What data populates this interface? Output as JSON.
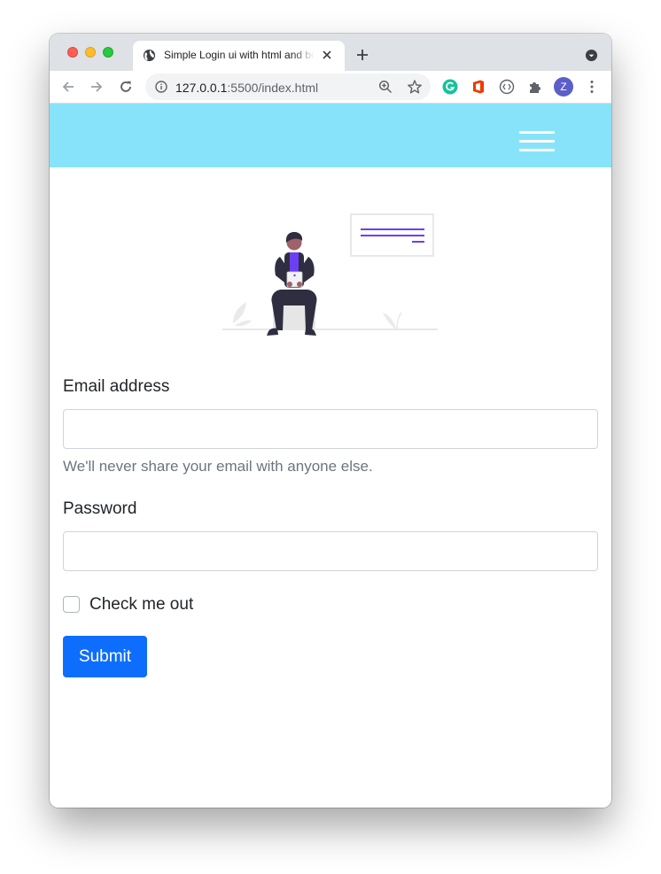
{
  "browser": {
    "tab_title": "Simple Login ui with html and bootstrap",
    "url_host": "127.0.0.1",
    "url_path": ":5500/index.html",
    "profile_initial": "Z",
    "icons": [
      "back-icon",
      "forward-icon",
      "reload-icon",
      "site-info-icon",
      "zoom-icon",
      "bookmark-star-icon",
      "grammarly-extension-icon",
      "office-extension-icon",
      "devtools-extension-icon",
      "extensions-puzzle-icon",
      "more-menu-icon"
    ]
  },
  "navbar": {
    "background": "#87e3f9",
    "toggler_icon": "hamburger-menu-icon"
  },
  "form": {
    "email_label": "Email address",
    "email_value": "",
    "email_help": "We'll never share your email with anyone else.",
    "password_label": "Password",
    "password_value": "",
    "checkbox_label": "Check me out",
    "checkbox_checked": false,
    "submit_label": "Submit",
    "submit_color": "#0d6efd"
  },
  "illustration": {
    "accent": "#6c3ff4"
  }
}
